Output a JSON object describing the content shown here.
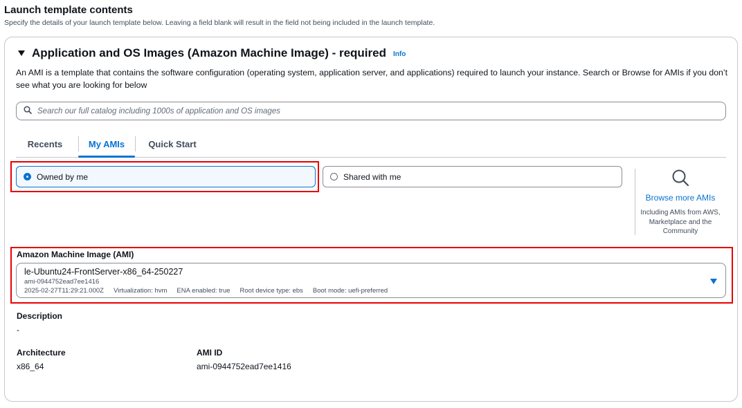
{
  "header": {
    "title": "Launch template contents",
    "subtitle": "Specify the details of your launch template below. Leaving a field blank will result in the field not being included in the launch template."
  },
  "section": {
    "title": "Application and OS Images (Amazon Machine Image) - required",
    "info_link": "Info",
    "description": "An AMI is a template that contains the software configuration (operating system, application server, and applications) required to launch your instance. Search or Browse for AMIs if you don’t see what you are looking for below"
  },
  "search": {
    "placeholder": "Search our full catalog including 1000s of application and OS images",
    "icon": "search-icon"
  },
  "tabs": [
    {
      "label": "Recents",
      "active": false
    },
    {
      "label": "My AMIs",
      "active": true
    },
    {
      "label": "Quick Start",
      "active": false
    }
  ],
  "ownership": {
    "options": [
      {
        "label": "Owned by me",
        "selected": true
      },
      {
        "label": "Shared with me",
        "selected": false
      }
    ]
  },
  "browse": {
    "icon": "magnifier-icon",
    "link": "Browse more AMIs",
    "description": "Including AMIs from AWS, Marketplace and the Community"
  },
  "ami": {
    "label": "Amazon Machine Image (AMI)",
    "name": "le-Ubuntu24-FrontServer-x86_64-250227",
    "id": "ami-0944752ead7ee1416",
    "created": "2025-02-27T11:29:21.000Z",
    "virtualization": "Virtualization: hvm",
    "ena": "ENA enabled: true",
    "root_device": "Root device type: ebs",
    "boot_mode": "Boot mode: uefi-preferred"
  },
  "details": {
    "description_label": "Description",
    "description_value": "-",
    "architecture_label": "Architecture",
    "architecture_value": "x86_64",
    "ami_id_label": "AMI ID",
    "ami_id_value": "ami-0944752ead7ee1416"
  },
  "colors": {
    "accent": "#0972d3",
    "highlight": "#e60000",
    "selected_bg": "#f2f8fd"
  }
}
